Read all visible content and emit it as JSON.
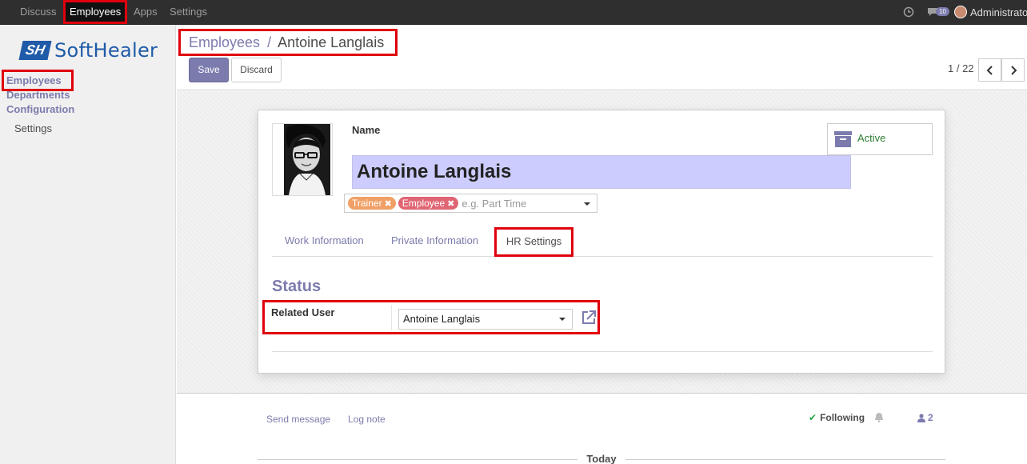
{
  "topbar": {
    "menu": [
      "Discuss",
      "Employees",
      "Apps",
      "Settings"
    ],
    "message_count": "10",
    "user": "Administrator"
  },
  "sidebar": {
    "logo_mark": "SH",
    "logo_text": "SoftHealer",
    "items": [
      "Employees",
      "Departments",
      "Configuration"
    ],
    "sub_items": [
      "Settings"
    ]
  },
  "control_panel": {
    "breadcrumb_parent": "Employees",
    "breadcrumb_sep": "/",
    "breadcrumb_current": "Antoine Langlais",
    "save_label": "Save",
    "discard_label": "Discard",
    "pager": "1 / 22"
  },
  "form": {
    "name_label": "Name",
    "name_value": "Antoine Langlais",
    "tags": [
      {
        "label": "Trainer",
        "color": "#f0a066"
      },
      {
        "label": "Employee",
        "color": "#e06573"
      }
    ],
    "tags_placeholder": "e.g. Part Time",
    "active_label": "Active",
    "tabs": [
      "Work Information",
      "Private Information",
      "HR Settings"
    ],
    "section_title": "Status",
    "related_user_label": "Related User",
    "related_user_value": "Antoine Langlais"
  },
  "chatter": {
    "send_message": "Send message",
    "log_note": "Log note",
    "following": "Following",
    "followers_count": "2",
    "today": "Today"
  },
  "colors": {
    "accent": "#7c7bad",
    "highlight": "#e0000c",
    "name_field_bg": "#ccccff",
    "active_green": "#2e7d32"
  }
}
